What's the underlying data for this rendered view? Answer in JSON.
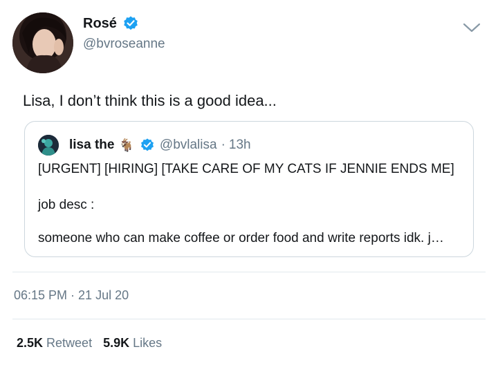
{
  "tweet": {
    "author": {
      "display_name": "Rosé",
      "handle": "@bvroseanne",
      "verified": true
    },
    "text": "Lisa, I don’t think this is a good idea...",
    "timestamp": {
      "time": "06:15 PM",
      "separator": "·",
      "date": "21 Jul 20"
    },
    "stats": {
      "retweets": {
        "value": "2.5K",
        "label": "Retweet"
      },
      "likes": {
        "value": "5.9K",
        "label": "Likes"
      }
    }
  },
  "quoted_tweet": {
    "author": {
      "display_name": "lisa the",
      "emoji": "🐐",
      "handle": "@bvlalisa",
      "verified": true
    },
    "separator": "·",
    "time_ago": "13h",
    "lines": [
      "[URGENT] [HIRING] [TAKE CARE OF MY CATS IF JENNIE ENDS ME]",
      "job desc :",
      "someone who can make coffee or order food and write reports idk. j…"
    ]
  },
  "icons": {
    "verified": "verified-badge-icon",
    "more": "chevron-down-icon"
  },
  "colors": {
    "verified_blue": "#1da1f2",
    "secondary_text": "#657786",
    "border": "#ccd6dd"
  }
}
